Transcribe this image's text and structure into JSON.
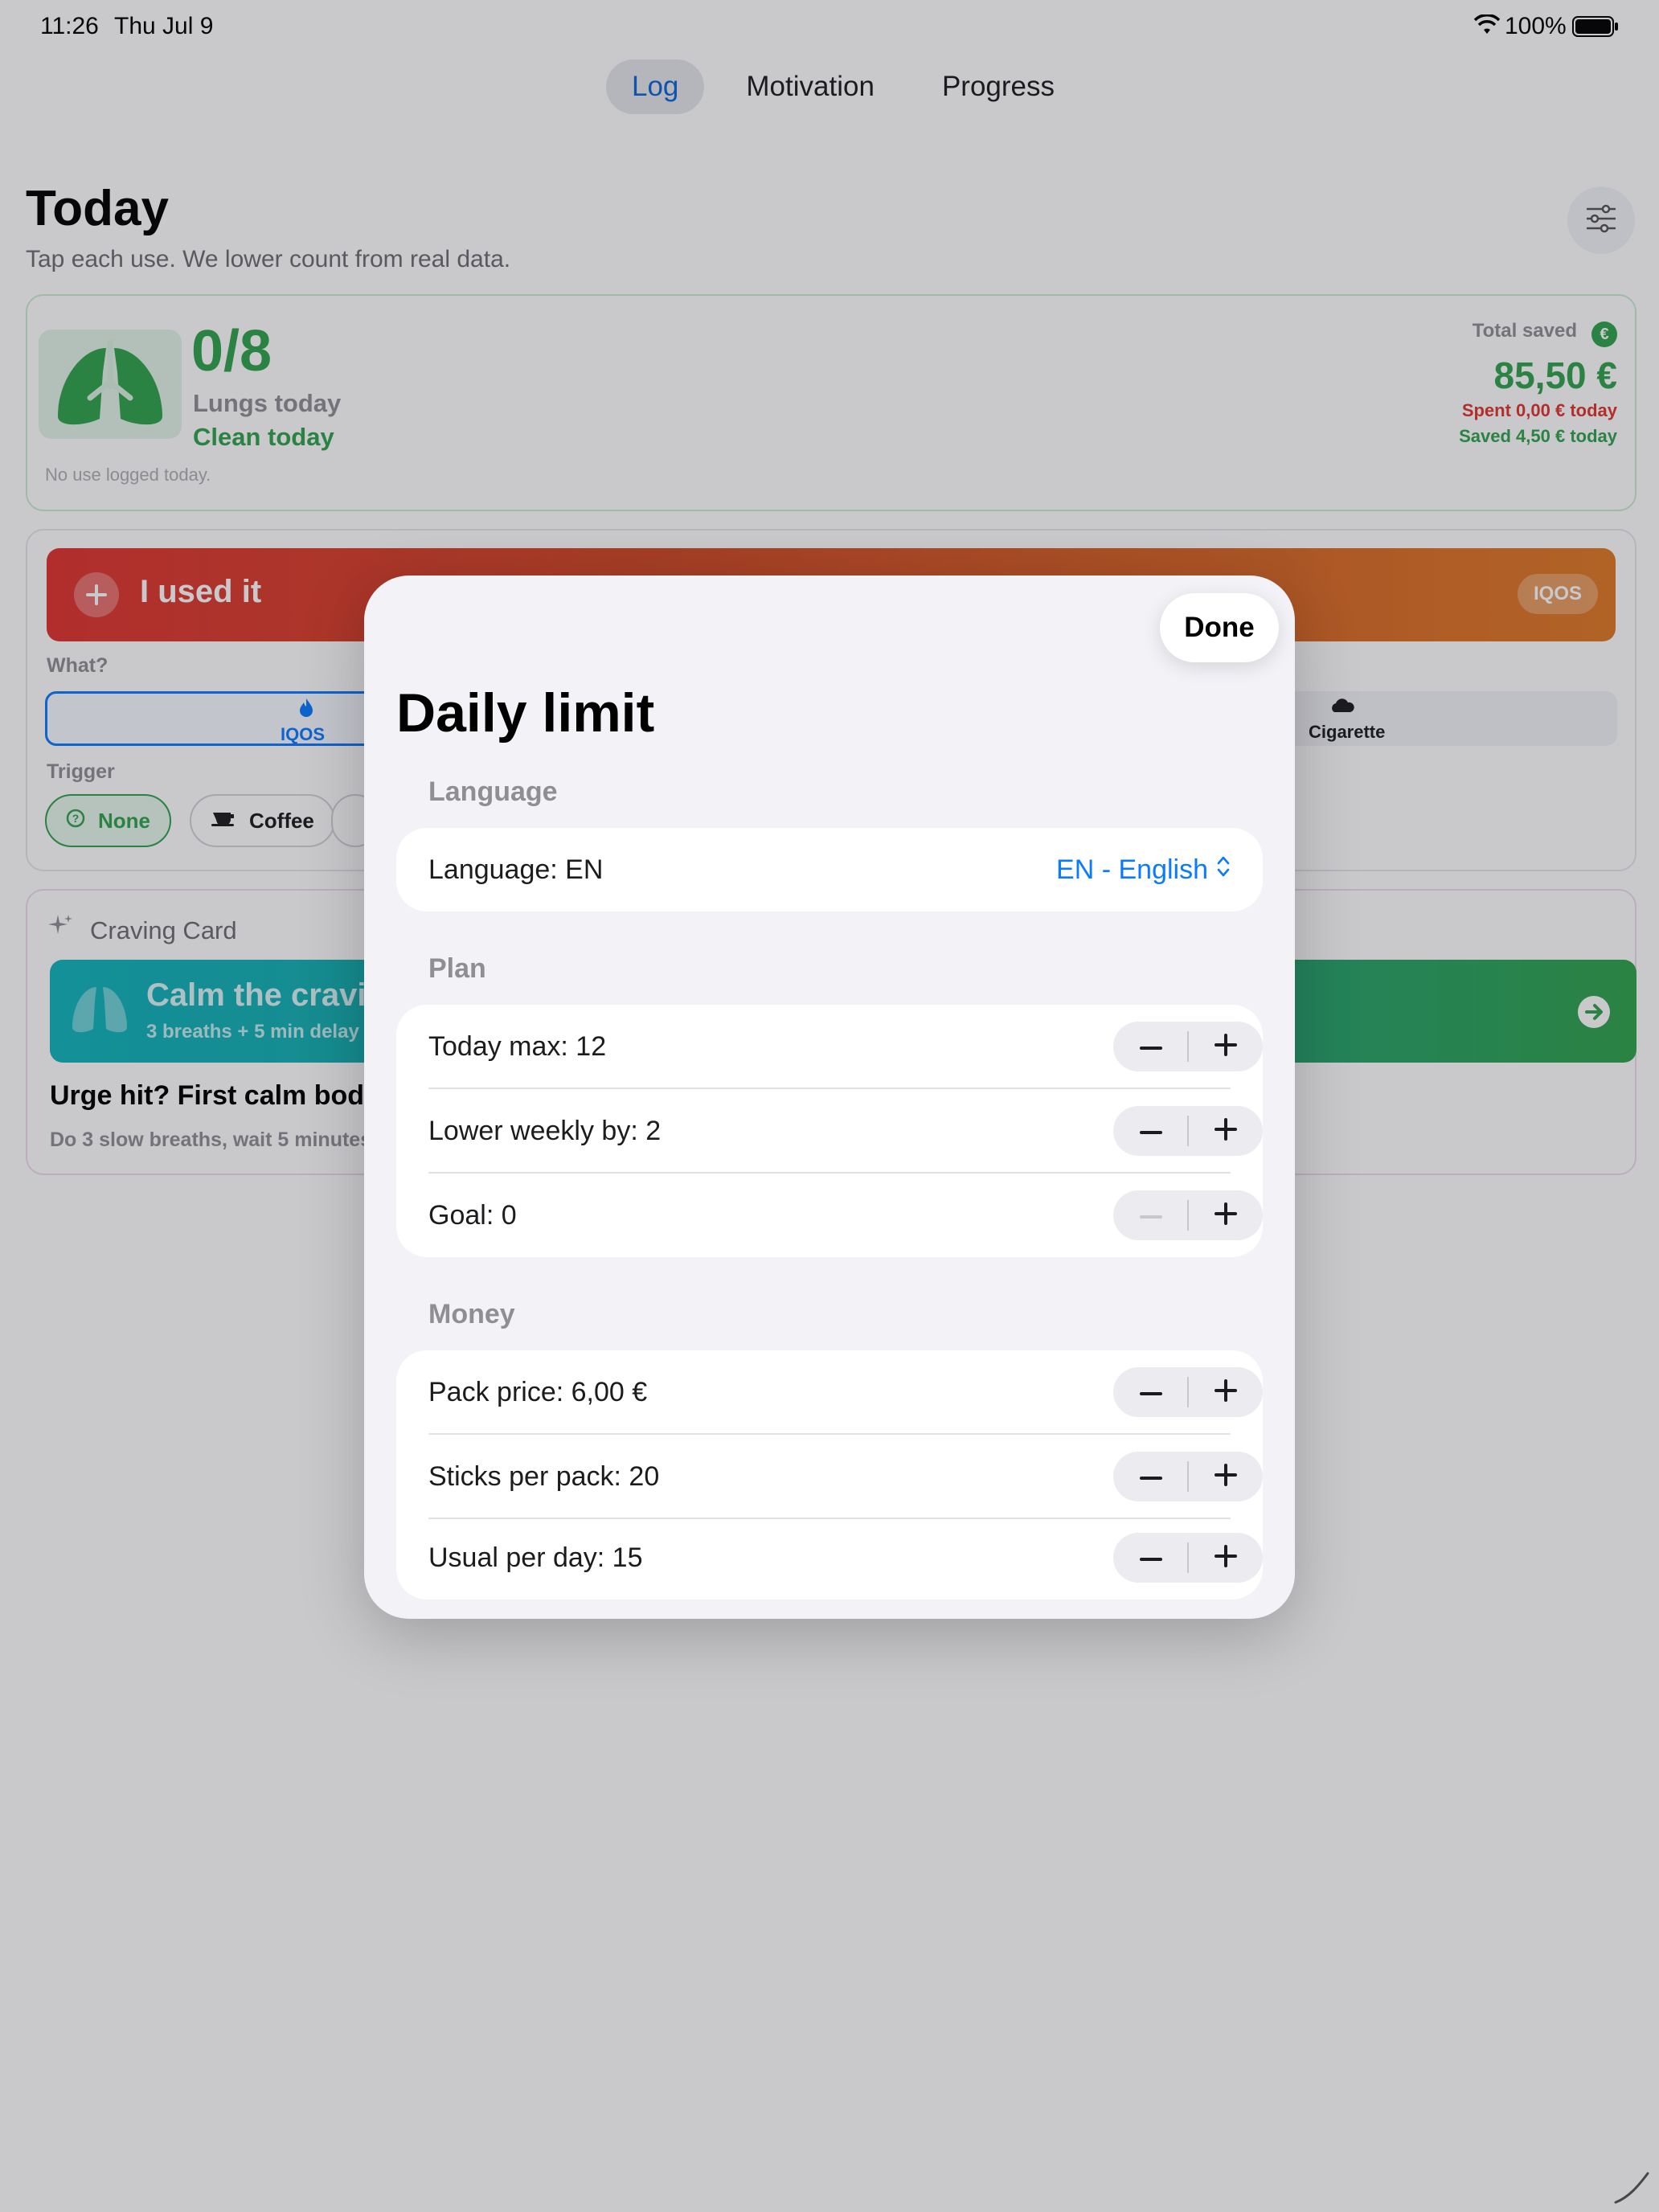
{
  "status_bar": {
    "time": "11:26",
    "date": "Thu Jul 9",
    "battery": "100%"
  },
  "tabs": [
    {
      "label": "Log",
      "active": true
    },
    {
      "label": "Motivation"
    },
    {
      "label": "Progress"
    }
  ],
  "today": {
    "title": "Today",
    "subtitle": "Tap each use. We lower count from real data.",
    "count": "0/8",
    "lungs_label": "Lungs today",
    "clean_label": "Clean today",
    "note": "No use logged today.",
    "total_saved_label": "Total saved",
    "total_saved_value": "85,50 €",
    "spent_today": "Spent 0,00 € today",
    "saved_today": "Saved 4,50 € today",
    "currency_badge": "€"
  },
  "use_panel": {
    "button_label": "I used it",
    "product_badge": "IQOS",
    "what_label": "What?",
    "what_options": [
      "IQOS",
      "Cigarette"
    ],
    "trigger_label": "Trigger",
    "trigger_options": [
      "None",
      "Coffee"
    ]
  },
  "craving": {
    "header": "Craving Card",
    "banner_title": "Calm the cravi",
    "banner_sub": "3 breaths + 5 min delay",
    "headline": "Urge hit? First calm body",
    "body": "Do 3 slow breaths, wait 5 minutes"
  },
  "sheet": {
    "done_label": "Done",
    "title": "Daily limit",
    "sections": {
      "language": {
        "header": "Language",
        "label": "Language: EN",
        "value": "EN - English"
      },
      "plan": {
        "header": "Plan",
        "rows": [
          {
            "label": "Today max: 12",
            "minus_enabled": true
          },
          {
            "label": "Lower weekly by: 2",
            "minus_enabled": true
          },
          {
            "label": "Goal: 0",
            "minus_enabled": false
          }
        ]
      },
      "money": {
        "header": "Money",
        "rows": [
          {
            "label": "Pack price: 6,00 €"
          },
          {
            "label": "Sticks per pack: 20"
          },
          {
            "label": "Usual per day: 15"
          }
        ]
      }
    }
  },
  "colors": {
    "accent_blue": "#0a7aff",
    "green": "#2fa24b",
    "red": "#e0342f",
    "orange": "#e07a25",
    "teal": "#10b4bc"
  }
}
